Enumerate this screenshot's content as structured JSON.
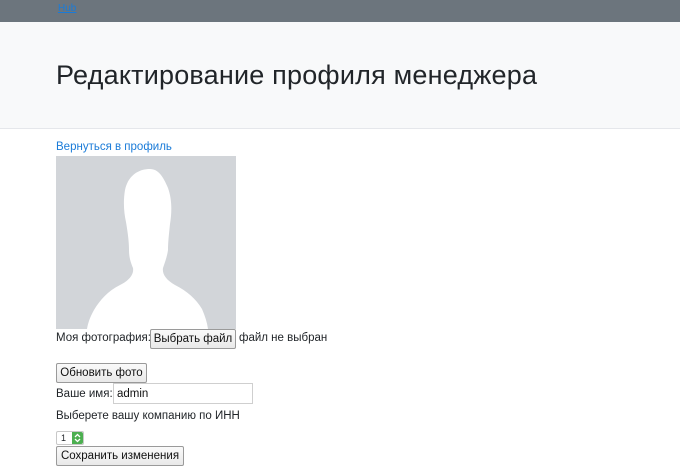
{
  "topbar": {
    "brand_label": "Hub",
    "background": "#6c757d",
    "link_color": "#1a7bd8"
  },
  "header": {
    "title": "Редактирование профиля менеджера"
  },
  "links": {
    "back_to_profile": "Вернуться в профиль"
  },
  "photo": {
    "label": "Моя фотография:",
    "choose_file_button": "Выбрать файл",
    "no_file_text": "файл не выбран",
    "update_button": "Обновить фото",
    "avatar_icon": "person-silhouette-icon"
  },
  "name": {
    "label": "Ваше имя:",
    "value": "admin"
  },
  "company": {
    "label": "Выберете вашу компанию по ИНН",
    "selected_value": "1"
  },
  "actions": {
    "save_button": "Сохранить изменения"
  }
}
